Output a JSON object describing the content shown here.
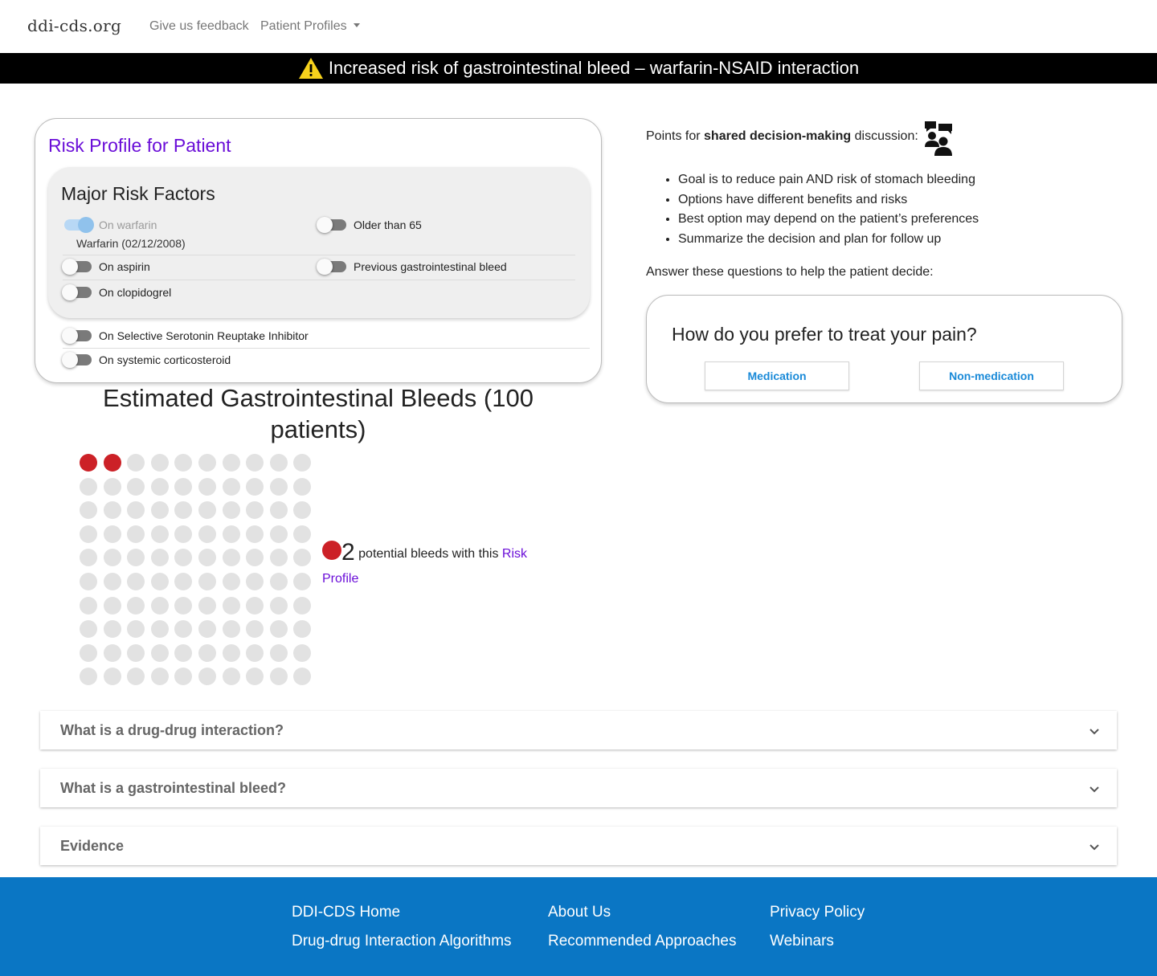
{
  "navbar": {
    "brand": "ddi-cds.org",
    "links": [
      {
        "label": "Give us feedback"
      },
      {
        "label": "Patient Profiles",
        "has_dropdown": true
      }
    ]
  },
  "alert": {
    "icon": "warning-triangle-icon",
    "text": "Increased risk of gastrointestinal bleed – warfarin-NSAID interaction"
  },
  "risk_profile": {
    "title": "Risk Profile for Patient",
    "major_title": "Major Risk Factors",
    "factors": [
      {
        "label": "On warfarin",
        "checked": true,
        "disabled": true,
        "detail": "Warfarin (02/12/2008)"
      },
      {
        "label": "Older than 65",
        "checked": false
      },
      {
        "label": "On aspirin",
        "checked": false
      },
      {
        "label": "Previous gastrointestinal bleed",
        "checked": false
      },
      {
        "label": "On clopidogrel",
        "checked": false
      },
      {
        "label": "On Selective Serotonin Reuptake Inhibitor",
        "checked": false
      },
      {
        "label": "On systemic corticosteroid",
        "checked": false
      }
    ]
  },
  "chart_data": {
    "type": "pictograph",
    "title": "Estimated Gastrointestinal Bleeds (100 patients)",
    "total": 100,
    "rows": 10,
    "columns": 10,
    "highlighted": 2,
    "highlight_color": "#cc2127",
    "base_color": "#e2e2e2",
    "legend": {
      "count": "2",
      "text": "potential bleeds with this",
      "link": "Risk Profile"
    }
  },
  "sdm": {
    "heading_prefix": "Points for ",
    "heading_bold": "shared decision-making",
    "heading_suffix": " discussion:",
    "icon": "people-discussion-icon",
    "points": [
      "Goal is to reduce pain AND risk of stomach bleeding",
      "Options have different benefits and risks",
      "Best option may depend on the patient’s preferences",
      "Summarize the decision and plan for follow up"
    ],
    "answer_prompt": "Answer these questions to help the patient decide:",
    "question": "How do you prefer to treat your pain?",
    "options": [
      "Medication",
      "Non-medication"
    ]
  },
  "accordions": [
    {
      "label": "What is a drug-drug interaction?"
    },
    {
      "label": "What is a gastrointestinal bleed?"
    },
    {
      "label": "Evidence"
    }
  ],
  "footer": {
    "links": [
      "DDI-CDS Home",
      "Drug-drug Interaction Algorithms",
      "About Us",
      "Recommended Approaches",
      "Privacy Policy",
      "Webinars"
    ]
  }
}
